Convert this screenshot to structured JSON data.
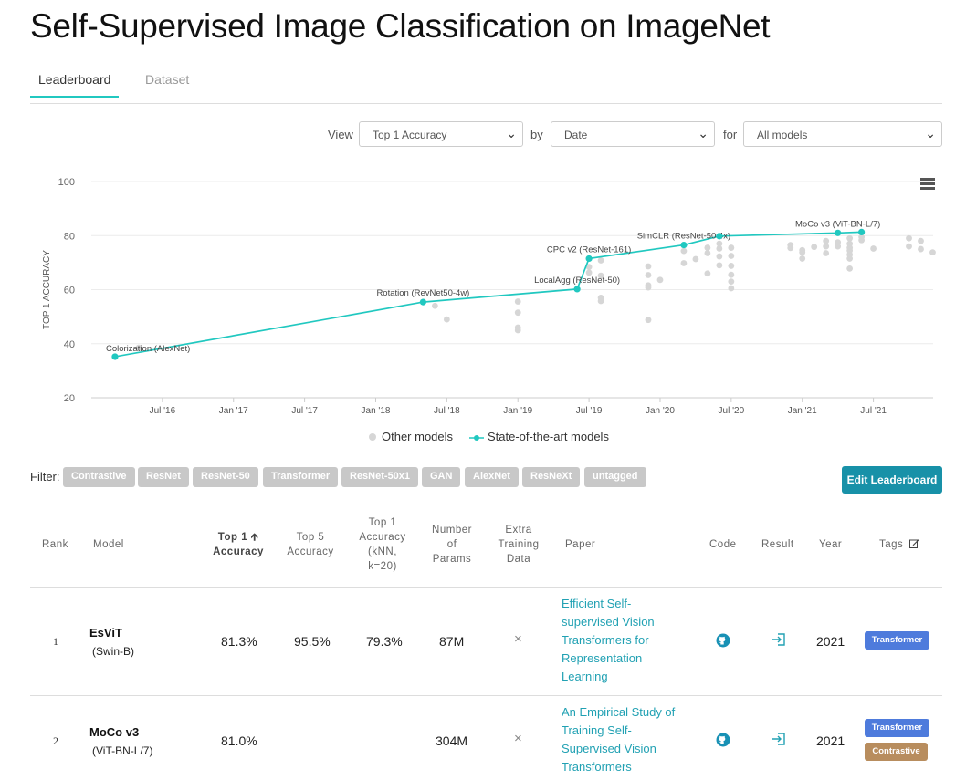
{
  "page_title": "Self-Supervised Image Classification on ImageNet",
  "tabs": [
    {
      "label": "Leaderboard",
      "active": true
    },
    {
      "label": "Dataset",
      "active": false
    }
  ],
  "controls": {
    "view_label": "View",
    "view_value": "Top 1 Accuracy",
    "by_label": "by",
    "by_value": "Date",
    "for_label": "for",
    "for_value": "All models"
  },
  "colors": {
    "accent": "#21c8c0",
    "link": "#21a1b3",
    "button": "#1891a8",
    "other_point": "#d6d6d6",
    "transformer_tag": "#4e7bdc",
    "contrastive_tag": "#b88d5e"
  },
  "chart_data": {
    "type": "scatter",
    "ylabel": "TOP 1 ACCURACY",
    "xlabel": "",
    "ylim": [
      20,
      100
    ],
    "y_ticks": [
      "100",
      "80",
      "60",
      "40",
      "20"
    ],
    "x_ticks": [
      "Jul '16",
      "Jan '17",
      "Jul '17",
      "Jan '18",
      "Jul '18",
      "Jan '19",
      "Jul '19",
      "Jan '20",
      "Jul '20",
      "Jan '21",
      "Jul '21"
    ],
    "legend": [
      "Other models",
      "State-of-the-art models"
    ],
    "grid": true,
    "series": [
      {
        "name": "State-of-the-art models",
        "points": [
          {
            "x": "2016-03",
            "y": 35.2,
            "label": "Colorization (AlexNet)"
          },
          {
            "x": "2018-05",
            "y": 55.4,
            "label": "Rotation (RevNet50-4w)"
          },
          {
            "x": "2019-06",
            "y": 60.2,
            "label": "LocalAgg (ResNet-50)"
          },
          {
            "x": "2019-07",
            "y": 71.5,
            "label": "CPC v2 (ResNet-161)"
          },
          {
            "x": "2020-03",
            "y": 76.5,
            "label": "SimCLR (ResNet-50 4x)"
          },
          {
            "x": "2020-06",
            "y": 79.8,
            "label": ""
          },
          {
            "x": "2021-04",
            "y": 81.0,
            "label": "MoCo v3 (ViT-BN-L/7)"
          },
          {
            "x": "2021-06",
            "y": 81.3,
            "label": ""
          }
        ]
      },
      {
        "name": "Other models",
        "points": [
          {
            "x": "2016-05",
            "y": 38.5
          },
          {
            "x": "2018-06",
            "y": 54.0
          },
          {
            "x": "2018-07",
            "y": 49.0
          },
          {
            "x": "2019-01",
            "y": 55.6
          },
          {
            "x": "2019-01",
            "y": 51.5
          },
          {
            "x": "2019-01",
            "y": 46.0
          },
          {
            "x": "2019-01",
            "y": 45.0
          },
          {
            "x": "2019-07",
            "y": 68.4
          },
          {
            "x": "2019-07",
            "y": 66.3
          },
          {
            "x": "2019-08",
            "y": 70.8
          },
          {
            "x": "2019-08",
            "y": 65.2
          },
          {
            "x": "2019-08",
            "y": 57.0
          },
          {
            "x": "2019-08",
            "y": 55.8
          },
          {
            "x": "2019-12",
            "y": 68.6
          },
          {
            "x": "2019-12",
            "y": 65.4
          },
          {
            "x": "2019-12",
            "y": 61.6
          },
          {
            "x": "2019-12",
            "y": 60.8
          },
          {
            "x": "2019-12",
            "y": 48.8
          },
          {
            "x": "2020-01",
            "y": 63.6
          },
          {
            "x": "2020-03",
            "y": 74.3
          },
          {
            "x": "2020-03",
            "y": 69.8
          },
          {
            "x": "2020-04",
            "y": 71.3
          },
          {
            "x": "2020-05",
            "y": 75.5
          },
          {
            "x": "2020-05",
            "y": 73.5
          },
          {
            "x": "2020-05",
            "y": 66.0
          },
          {
            "x": "2020-06",
            "y": 77.0
          },
          {
            "x": "2020-06",
            "y": 75.2
          },
          {
            "x": "2020-06",
            "y": 72.3
          },
          {
            "x": "2020-06",
            "y": 69.0
          },
          {
            "x": "2020-07",
            "y": 75.5
          },
          {
            "x": "2020-07",
            "y": 72.5
          },
          {
            "x": "2020-07",
            "y": 68.8
          },
          {
            "x": "2020-07",
            "y": 65.5
          },
          {
            "x": "2020-07",
            "y": 63.0
          },
          {
            "x": "2020-07",
            "y": 60.5
          },
          {
            "x": "2020-12",
            "y": 76.5
          },
          {
            "x": "2020-12",
            "y": 75.4
          },
          {
            "x": "2021-01",
            "y": 74.6
          },
          {
            "x": "2021-01",
            "y": 73.8
          },
          {
            "x": "2021-01",
            "y": 71.5
          },
          {
            "x": "2021-02",
            "y": 75.8
          },
          {
            "x": "2021-03",
            "y": 78.0
          },
          {
            "x": "2021-03",
            "y": 76.0
          },
          {
            "x": "2021-03",
            "y": 73.5
          },
          {
            "x": "2021-04",
            "y": 77.5
          },
          {
            "x": "2021-04",
            "y": 76.0
          },
          {
            "x": "2021-05",
            "y": 79.0
          },
          {
            "x": "2021-05",
            "y": 77.0
          },
          {
            "x": "2021-05",
            "y": 75.5
          },
          {
            "x": "2021-05",
            "y": 74.5
          },
          {
            "x": "2021-05",
            "y": 73.0
          },
          {
            "x": "2021-05",
            "y": 71.5
          },
          {
            "x": "2021-05",
            "y": 67.8
          },
          {
            "x": "2021-06",
            "y": 79.5
          },
          {
            "x": "2021-06",
            "y": 78.3
          },
          {
            "x": "2021-07",
            "y": 75.2
          },
          {
            "x": "2021-10",
            "y": 79.0
          },
          {
            "x": "2021-10",
            "y": 76.0
          },
          {
            "x": "2021-11",
            "y": 78.0
          },
          {
            "x": "2021-11",
            "y": 75.0
          },
          {
            "x": "2021-12",
            "y": 73.8
          }
        ]
      }
    ]
  },
  "filter": {
    "label": "Filter:",
    "chips": [
      "Contrastive",
      "ResNet",
      "ResNet-50",
      "Transformer",
      "ResNet-50x1",
      "GAN",
      "AlexNet",
      "ResNeXt",
      "untagged"
    ]
  },
  "edit_button": "Edit Leaderboard",
  "table": {
    "headers": {
      "rank": "Rank",
      "model": "Model",
      "top1": [
        "Top 1",
        "Accuracy"
      ],
      "top5": [
        "Top 5",
        "Accuracy"
      ],
      "knn": [
        "Top 1",
        "Accuracy",
        "(kNN,",
        "k=20)"
      ],
      "params": [
        "Number",
        "of",
        "Params"
      ],
      "extra": [
        "Extra",
        "Training",
        "Data"
      ],
      "paper": "Paper",
      "code": "Code",
      "result": "Result",
      "year": "Year",
      "tags": "Tags"
    },
    "rows": [
      {
        "rank": "1",
        "model": "EsViT",
        "model_sub": "(Swin-B)",
        "top1": "81.3%",
        "top5": "95.5%",
        "knn": "79.3%",
        "params": "87M",
        "extra": "×",
        "paper": [
          "Efficient Self-",
          "supervised Vision",
          "Transformers for",
          "Representation",
          "Learning"
        ],
        "year": "2021",
        "tags": [
          "Transformer"
        ]
      },
      {
        "rank": "2",
        "model": "MoCo v3",
        "model_sub": "(ViT-BN-L/7)",
        "top1": "81.0%",
        "top5": "",
        "knn": "",
        "params": "304M",
        "extra": "×",
        "paper": [
          "An Empirical Study of",
          "Training Self-",
          "Supervised Vision",
          "Transformers"
        ],
        "year": "2021",
        "tags": [
          "Transformer",
          "Contrastive"
        ]
      }
    ]
  }
}
